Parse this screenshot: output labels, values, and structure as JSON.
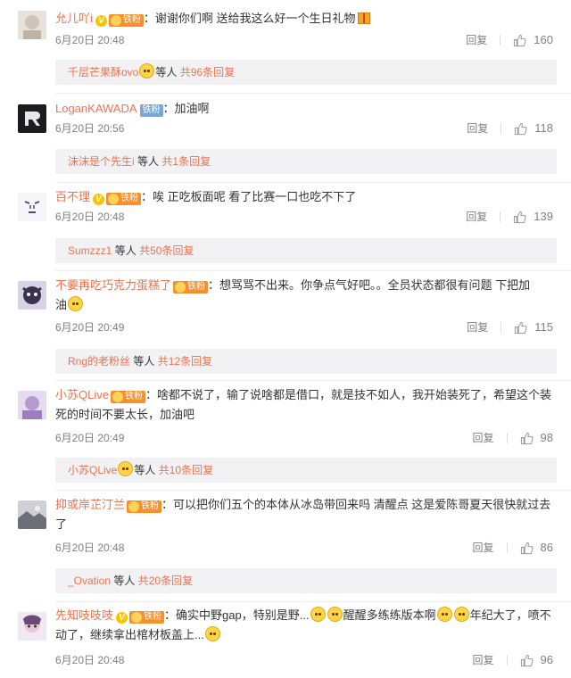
{
  "ui": {
    "reply_label": "回复",
    "fan_badge": "铁粉",
    "v_badge": "V",
    "others_label": "等人",
    "total_prefix": "共",
    "total_suffix": "条回复",
    "colon": "："
  },
  "comments": [
    {
      "user": "允儿吖i",
      "text": "谢谢你们啊 送给我这么好一个生日礼物",
      "time": "6月20日 20:48",
      "likes": "160",
      "sub_user": "千层芒果酥ovo",
      "sub_count": "96"
    },
    {
      "user": "LoganKAWADA",
      "text": "加油啊",
      "time": "6月20日 20:56",
      "likes": "118",
      "sub_user": "沫沫是个先生i",
      "sub_count": "1"
    },
    {
      "user": "百不理",
      "text": "唉 正吃板面呢 看了比赛一口也吃不下了",
      "time": "6月20日 20:48",
      "likes": "139",
      "sub_user": "Sumzzz1",
      "sub_count": "50"
    },
    {
      "user": "不要再吃巧克力蛋糕了",
      "text": "想骂骂不出来。你争点气好吧。。全员状态都很有问题 下把加",
      "text2": "油",
      "time": "6月20日 20:49",
      "likes": "115",
      "sub_user": "Rng的老粉丝",
      "sub_count": "12"
    },
    {
      "user": "小苏QLive",
      "text": "啥都不说了，输了说啥都是借口，就是技不如人，我开始装死了，希望这个装",
      "text2": "死的时间不要太长，加油吧",
      "time": "6月20日 20:49",
      "likes": "98",
      "sub_user": "小苏QLive",
      "sub_count": "10"
    },
    {
      "user": "抑或岸芷汀兰",
      "text": "可以把你们五个的本体从冰岛带回来吗 清醒点 这是爱陈哥夏天很快就过去",
      "text2": "了",
      "time": "6月20日 20:48",
      "likes": "86",
      "sub_user": "_Ovation",
      "sub_count": "20"
    },
    {
      "user": "先知吱吱吱",
      "text_a": "确实中野gap，特别是野...",
      "text_b": "醒醒多练练版本啊",
      "text_c": "年纪大了，喷不",
      "text2": "动了，继续拿出棺材板盖上...",
      "time": "6月20日 20:48",
      "likes": "96"
    }
  ]
}
